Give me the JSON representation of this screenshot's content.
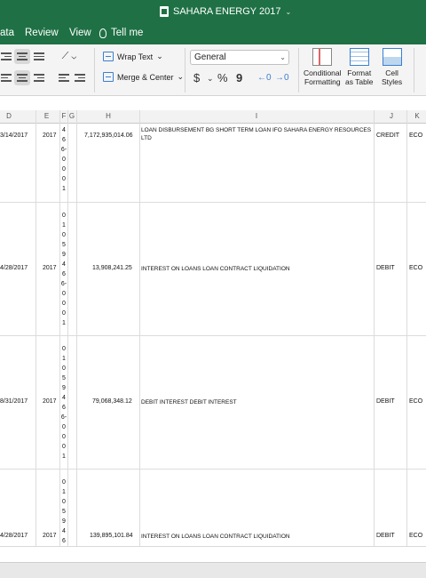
{
  "window": {
    "title": "SAHARA ENERGY 2017"
  },
  "menu": {
    "data": "ata",
    "review": "Review",
    "view": "View",
    "tell_me": "Tell me"
  },
  "ribbon": {
    "wrap_text": "Wrap Text",
    "merge_center": "Merge & Center",
    "number_format": "General",
    "dollar": "$",
    "percent": "%",
    "comma": "9",
    "conditional_formatting": "Conditional\nFormatting",
    "format_as_table": "Format\nas Table",
    "cell_styles": "Cell\nStyles"
  },
  "columns": [
    "D",
    "E",
    "F",
    "G",
    "H",
    "I",
    "J",
    "K"
  ],
  "rows": [
    {
      "date": "3/14/2017",
      "year": "",
      "ref": "4 6 6- 0 0 0 1",
      "amount": "7,172,935,014.06",
      "description": "LOAN DISBURSEMENT BG SHORT TERM LOAN IFO SAHARA ENERGY RESOURCES LTD",
      "type": "CREDIT",
      "k": "ECO"
    },
    {
      "date": "4/28/2017",
      "year": "2017",
      "ref": "0 1 0 5 9 4 6 6- 0 0 0 1",
      "amount": "13,908,241.25",
      "description": "INTEREST ON LOANS LOAN CONTRACT LIQUIDATION",
      "type": "DEBIT",
      "k": "ECO"
    },
    {
      "date": "8/31/2017",
      "year": "2017",
      "ref": "0 1 0 5 9 4 6 6- 0 0 0 1",
      "amount": "79,068,348.12",
      "description": "DEBIT INTEREST DEBIT INTEREST",
      "type": "DEBIT",
      "k": "ECO"
    },
    {
      "date": "4/28/2017",
      "year": "2017",
      "ref": "0 1 0 5 9 4 6",
      "amount": "139,895,101.84",
      "description": "INTEREST ON LOANS LOAN CONTRACT LIQUIDATION",
      "type": "DEBIT",
      "k": "ECO"
    }
  ],
  "row1_year": "2017"
}
